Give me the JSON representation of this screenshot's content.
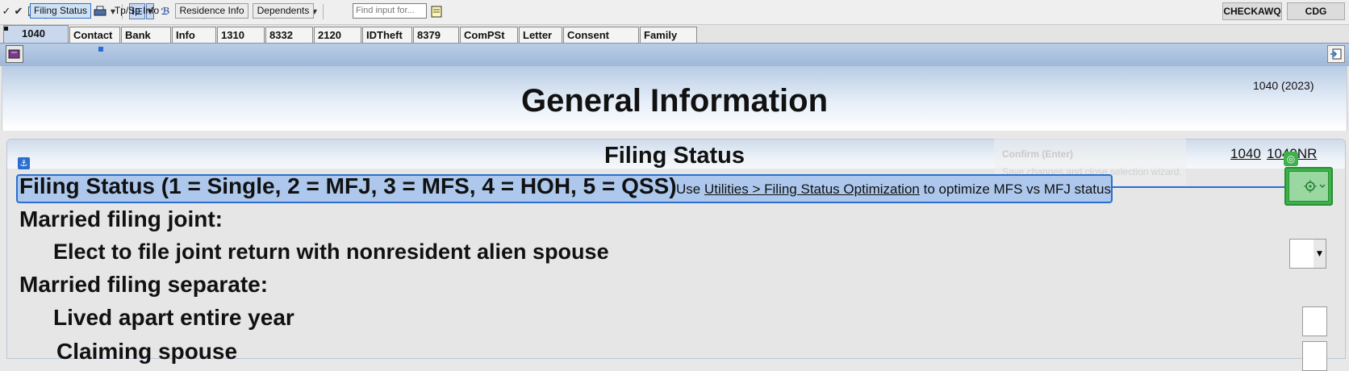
{
  "toolbar": {
    "icons": [
      "check-icon",
      "checkmark-icon",
      "envelope-icon",
      "printer-icon",
      "print-preview-icon",
      "print-setup-icon",
      "text-style-icon",
      "spell-check-icon",
      "font-icon",
      "ie-icon",
      "bug-icon",
      "image-icon",
      "search-help-icon",
      "help-icon"
    ],
    "find_placeholder": "Find input for...",
    "right_buttons": [
      "CHECKAWQ",
      "CDG"
    ]
  },
  "tabs": [
    "1040",
    "Contact",
    "Bank",
    "Info",
    "1310",
    "8332",
    "2120",
    "IDTheft",
    "8379",
    "ComPSt",
    "Letter",
    "Consent",
    "Family"
  ],
  "subtabs": [
    "Filing Status",
    "Tp/Sp  Info",
    "Residence Info",
    "Dependents"
  ],
  "header": {
    "title": "General Information",
    "form_id": "1040 (2023)"
  },
  "section": {
    "title": "Filing Status",
    "links": [
      "1040",
      "1040NR"
    ],
    "confirm_title": "Confirm (Enter)",
    "confirm_desc": "Save changes and close selection wizard."
  },
  "filing_status": {
    "label": "Filing Status (1 = Single, 2 = MFJ, 3 = MFS, 4 = HOH, 5 = QSS)",
    "hint_prefix": "Use ",
    "hint_link": "Utilities > Filing Status Optimization",
    "hint_suffix": " to optimize MFS vs MFJ status"
  },
  "rows": {
    "mfj_heading": "Married filing joint:",
    "nra_elect": "Elect to file joint return with nonresident alien spouse",
    "mfs_heading": "Married filing separate:",
    "lived_apart": "Lived apart entire year",
    "claiming_spouse": "Claiming spouse"
  },
  "colors": {
    "accent_blue": "#2a6fd0",
    "selection_green": "#3db14a",
    "row_highlight": "#adc8ec"
  }
}
